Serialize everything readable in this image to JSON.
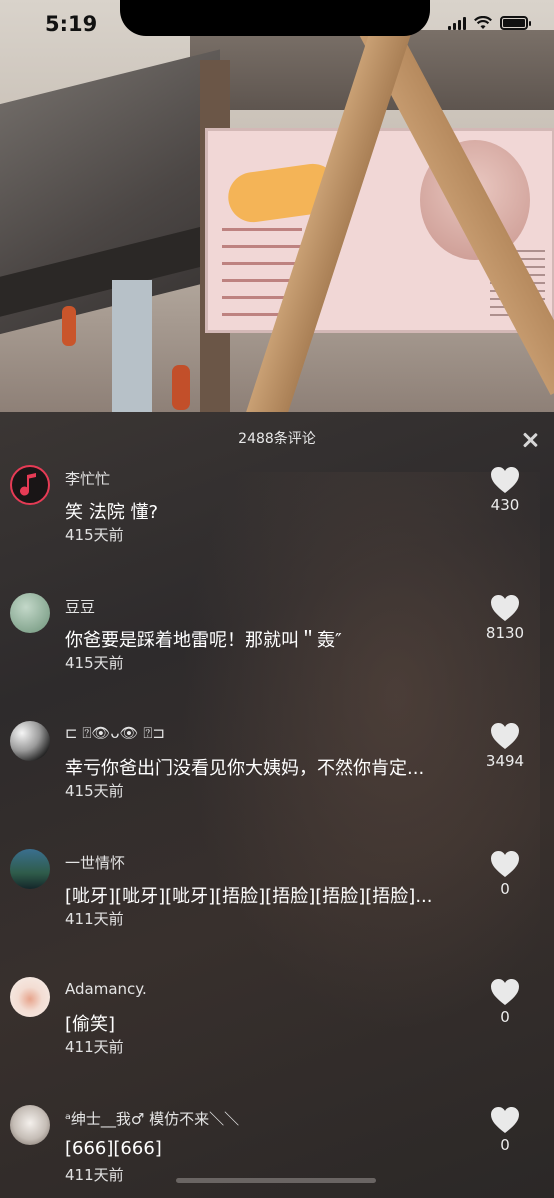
{
  "status_bar": {
    "time": "5:19"
  },
  "panel": {
    "title": "2488条评论"
  },
  "comments": [
    {
      "author": "李忙忙",
      "text": "笑 法院 懂?",
      "age": "415天前",
      "likes": "430"
    },
    {
      "author": "豆豆",
      "text": "你爸要是踩着地雷呢！那就叫＂轰″",
      "age": "415天前",
      "likes": "8130"
    },
    {
      "author": "⊏ ⍰👁ᴗ👁 ⍰⊐",
      "text": "幸亏你爸出门没看见你大姨妈，不然你肯定...",
      "age": "415天前",
      "likes": "3494"
    },
    {
      "author": "一世情怀",
      "text": "[呲牙][呲牙][呲牙][捂脸][捂脸][捂脸][捂脸]...",
      "age": "411天前",
      "likes": "0"
    },
    {
      "author": "Adamancy.",
      "text": "[偷笑]",
      "age": "411天前",
      "likes": "0"
    },
    {
      "author": "ᵃ绅士__我♂ 模仿不来＼＼",
      "text": "[666][666]",
      "age": "411天前",
      "likes": "0"
    }
  ]
}
